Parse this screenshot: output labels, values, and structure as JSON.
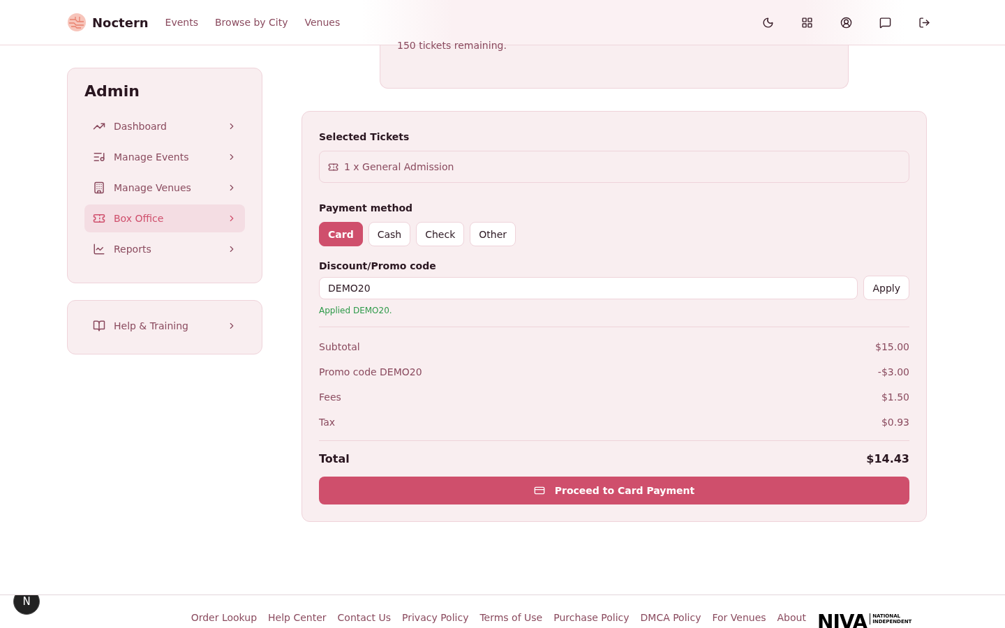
{
  "header": {
    "brand": "Noctern",
    "nav": [
      "Events",
      "Browse by City",
      "Venues"
    ]
  },
  "ticket_card": {
    "remaining": "150 tickets remaining."
  },
  "sidebar": {
    "title": "Admin",
    "items": [
      {
        "label": "Dashboard",
        "selected": false
      },
      {
        "label": "Manage Events",
        "selected": false
      },
      {
        "label": "Manage Venues",
        "selected": false
      },
      {
        "label": "Box Office",
        "selected": true
      },
      {
        "label": "Reports",
        "selected": false
      }
    ],
    "help": {
      "label": "Help & Training"
    }
  },
  "checkout": {
    "selected_title": "Selected Tickets",
    "ticket": "1 x General Admission",
    "payment_title": "Payment method",
    "methods": [
      {
        "label": "Card",
        "selected": true
      },
      {
        "label": "Cash",
        "selected": false
      },
      {
        "label": "Check",
        "selected": false
      },
      {
        "label": "Other",
        "selected": false
      }
    ],
    "promo_title": "Discount/Promo code",
    "promo_value": "DEMO20",
    "apply": "Apply",
    "promo_status": "Applied DEMO20.",
    "lines": [
      {
        "label": "Subtotal",
        "amount": "$15.00"
      },
      {
        "label": "Promo code DEMO20",
        "amount": "-$3.00"
      },
      {
        "label": "Fees",
        "amount": "$1.50"
      },
      {
        "label": "Tax",
        "amount": "$0.93"
      }
    ],
    "total_label": "Total",
    "total": "$14.43",
    "proceed": "Proceed to Card Payment"
  },
  "footer": {
    "links": [
      "Order Lookup",
      "Help Center",
      "Contact Us",
      "Privacy Policy",
      "Terms of Use",
      "Purchase Policy",
      "DMCA Policy",
      "For Venues",
      "About"
    ],
    "logo": "NIVA",
    "logo_lines": [
      "NATIONAL",
      "INDEPENDENT"
    ]
  },
  "dev_badge": "N"
}
